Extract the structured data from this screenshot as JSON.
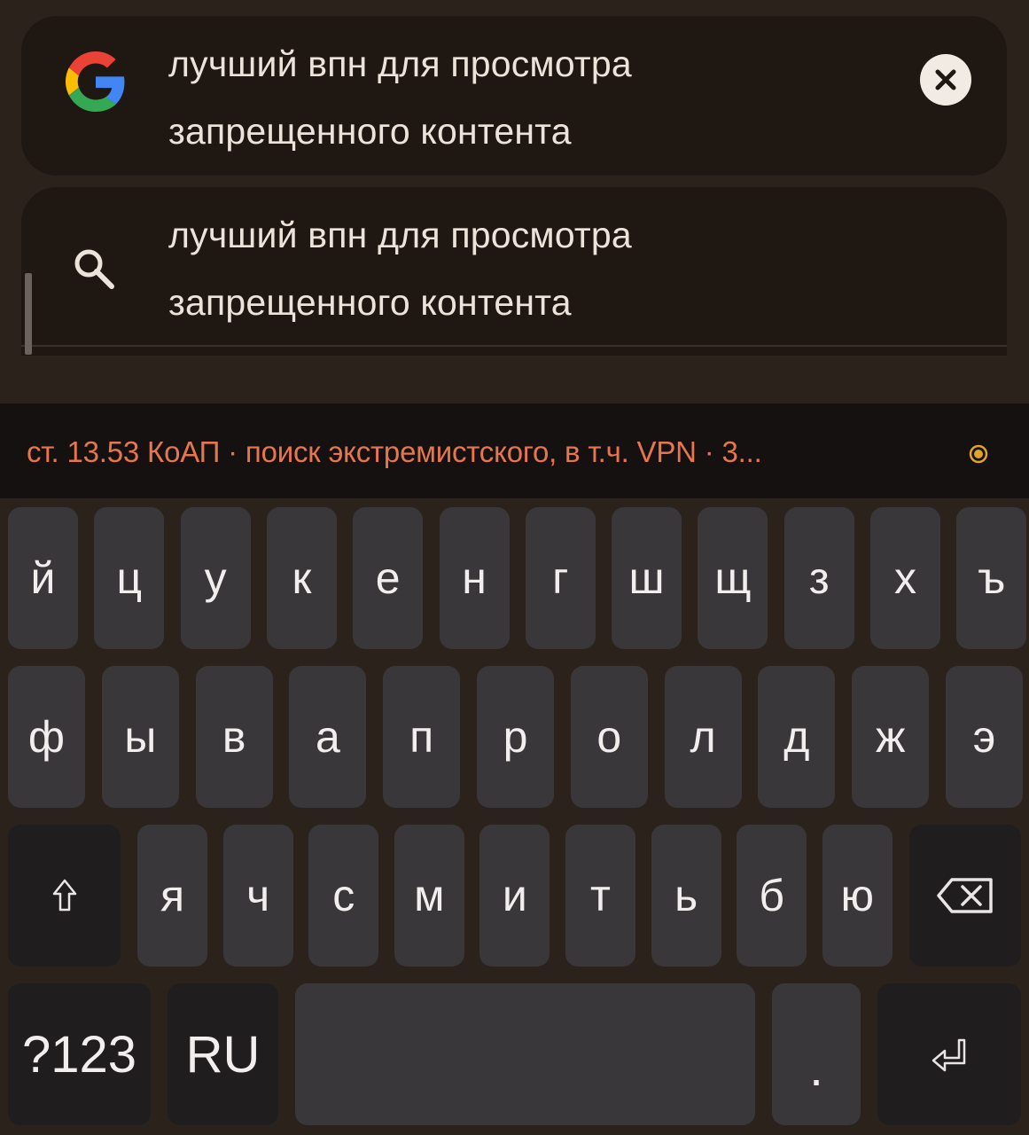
{
  "results": [
    {
      "icon": "google-g-icon",
      "line1": "лучший впн для просмотра",
      "line2": "запрещенного контента",
      "clear_icon": "close-icon"
    },
    {
      "icon": "search-icon",
      "line1": "лучший впн для просмотра",
      "line2": "запрещенного контента"
    }
  ],
  "suggestion": {
    "text": "ст. 13.53 КоАП · поиск экстремистского, в т.ч. VPN · 3...",
    "color": "#e7764f",
    "indicator_color": "#e0a32a"
  },
  "keyboard": {
    "row1": [
      "й",
      "ц",
      "у",
      "к",
      "е",
      "н",
      "г",
      "ш",
      "щ",
      "з",
      "х",
      "ъ"
    ],
    "row2": [
      "ф",
      "ы",
      "в",
      "а",
      "п",
      "р",
      "о",
      "л",
      "д",
      "ж",
      "э"
    ],
    "row3": [
      "я",
      "ч",
      "с",
      "м",
      "и",
      "т",
      "ь",
      "б",
      "ю"
    ],
    "shift_icon": "shift-arrow-icon",
    "backspace_icon": "backspace-icon",
    "symbols_label": "?123",
    "lang_label": "RU",
    "period_label": ".",
    "enter_icon": "enter-icon"
  }
}
